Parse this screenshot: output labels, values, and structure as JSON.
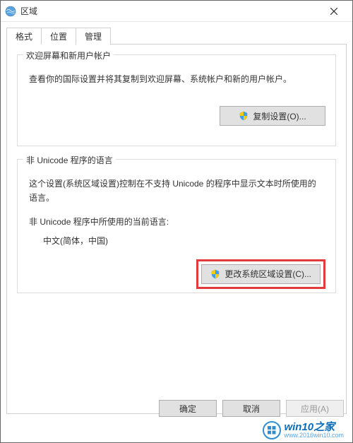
{
  "window": {
    "title": "区域"
  },
  "tabs": {
    "format": "格式",
    "location": "位置",
    "admin": "管理"
  },
  "welcome_group": {
    "title": "欢迎屏幕和新用户帐户",
    "desc": "查看你的国际设置并将其复制到欢迎屏幕、系统帐户和新的用户帐户。",
    "copy_button": "复制设置(O)..."
  },
  "nonunicode_group": {
    "title": "非 Unicode 程序的语言",
    "desc": "这个设置(系统区域设置)控制在不支持 Unicode 的程序中显示文本时所使用的语言。",
    "current_label": "非 Unicode 程序中所使用的当前语言:",
    "current_value": "中文(简体，中国)",
    "change_button": "更改系统区域设置(C)..."
  },
  "buttons": {
    "ok": "确定",
    "cancel": "取消",
    "apply": "应用(A)"
  },
  "watermark": {
    "main": "win10之家",
    "sub": "www.2016win10.com"
  }
}
